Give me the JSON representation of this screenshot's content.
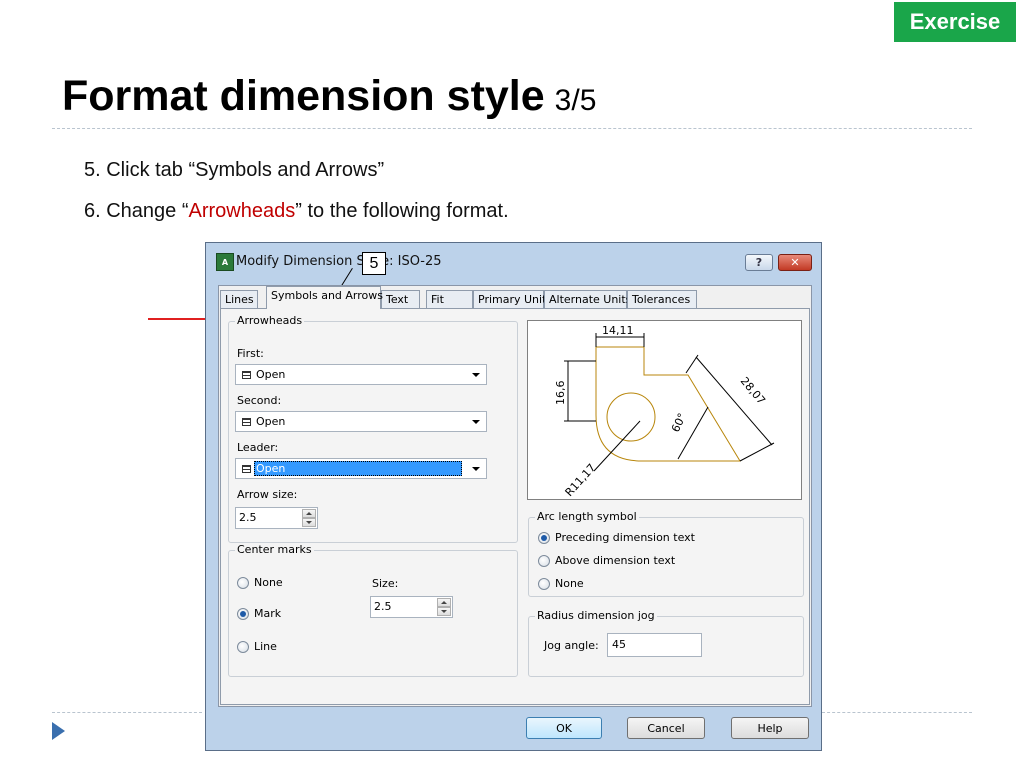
{
  "badge": "Exercise",
  "slide": {
    "title": "Format dimension style",
    "title_suffix": "3/5",
    "steps": [
      {
        "text": "5. Click tab “Symbols and Arrows”"
      },
      {
        "prefix": "6. Change “",
        "highlight": "Arrowheads",
        "suffix": "” to the following format."
      }
    ],
    "accent_color": "#c00000",
    "badge_color": "#1aa64a"
  },
  "dialog": {
    "app_icon": "A",
    "title": "Modify Dimension Style: ISO-25",
    "callout": "5",
    "help_button": "?",
    "close_button": "✕",
    "tabs": [
      "Lines",
      "Symbols and Arrows",
      "Text",
      "Fit",
      "Primary Units",
      "Alternate Units",
      "Tolerances"
    ],
    "active_tab": "Symbols and Arrows",
    "arrowheads": {
      "group_label": "Arrowheads",
      "first_label": "First:",
      "first_value": "Open",
      "second_label": "Second:",
      "second_value": "Open",
      "leader_label": "Leader:",
      "leader_value": "Open",
      "arrow_size_label": "Arrow size:",
      "arrow_size_value": "2.5"
    },
    "center_marks": {
      "group_label": "Center marks",
      "options": [
        "None",
        "Mark",
        "Line"
      ],
      "selected": "Mark",
      "size_label": "Size:",
      "size_value": "2.5"
    },
    "preview": {
      "dim_top": "14,11",
      "dim_left": "16,6",
      "dim_diag": "28,07",
      "angle": "60°",
      "radius": "R11,17"
    },
    "arc_length_symbol": {
      "group_label": "Arc length symbol",
      "options": [
        "Preceding dimension text",
        "Above dimension text",
        "None"
      ],
      "selected": "Preceding dimension text"
    },
    "radius_jog": {
      "group_label": "Radius dimension jog",
      "jog_angle_label": "Jog angle:",
      "jog_angle_value": "45"
    },
    "buttons": {
      "ok": "OK",
      "cancel": "Cancel",
      "help": "Help"
    }
  }
}
